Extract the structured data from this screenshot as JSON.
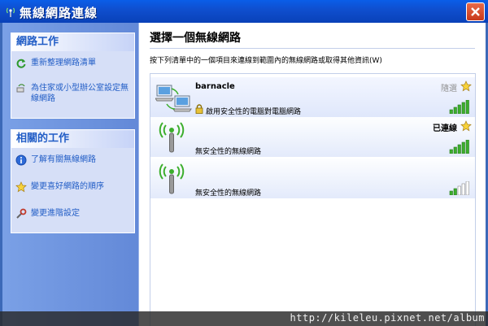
{
  "window": {
    "title": "無線網路連線"
  },
  "sidebar": {
    "network_tasks": {
      "heading": "網路工作",
      "items": [
        {
          "label": "重新整理網路清單",
          "icon": "refresh-icon"
        },
        {
          "label": "為住家或小型辦公室設定無線網路",
          "icon": "wireless-setup-icon"
        }
      ]
    },
    "related_tasks": {
      "heading": "相關的工作",
      "items": [
        {
          "label": "了解有關無線網路",
          "icon": "info-icon"
        },
        {
          "label": "變更喜好網路的順序",
          "icon": "star-icon"
        },
        {
          "label": "變更進階設定",
          "icon": "settings-icon"
        }
      ]
    }
  },
  "main": {
    "title": "選擇一個無線網路",
    "description": "按下列清單中的一個項目來連線到範圍內的無線網路或取得其他資訊(W)",
    "networks": [
      {
        "name": "barnacle",
        "security": "啟用安全性的電腦對電腦網路",
        "status": "隨選",
        "signal": 5,
        "secured": true,
        "type": "ad-hoc"
      },
      {
        "name": "",
        "security": "無安全性的無線網路",
        "status": "已連線",
        "signal": 5,
        "secured": false,
        "type": "access-point"
      },
      {
        "name": "",
        "security": "無安全性的無線網路",
        "status": "",
        "signal": 2,
        "secured": false,
        "type": "access-point"
      }
    ]
  },
  "watermark": {
    "text": "http://kileleu.pixnet.net/album"
  },
  "colors": {
    "titlebar": "#0a5ee8",
    "link": "#215dc6",
    "signal": "#3cae2c"
  }
}
